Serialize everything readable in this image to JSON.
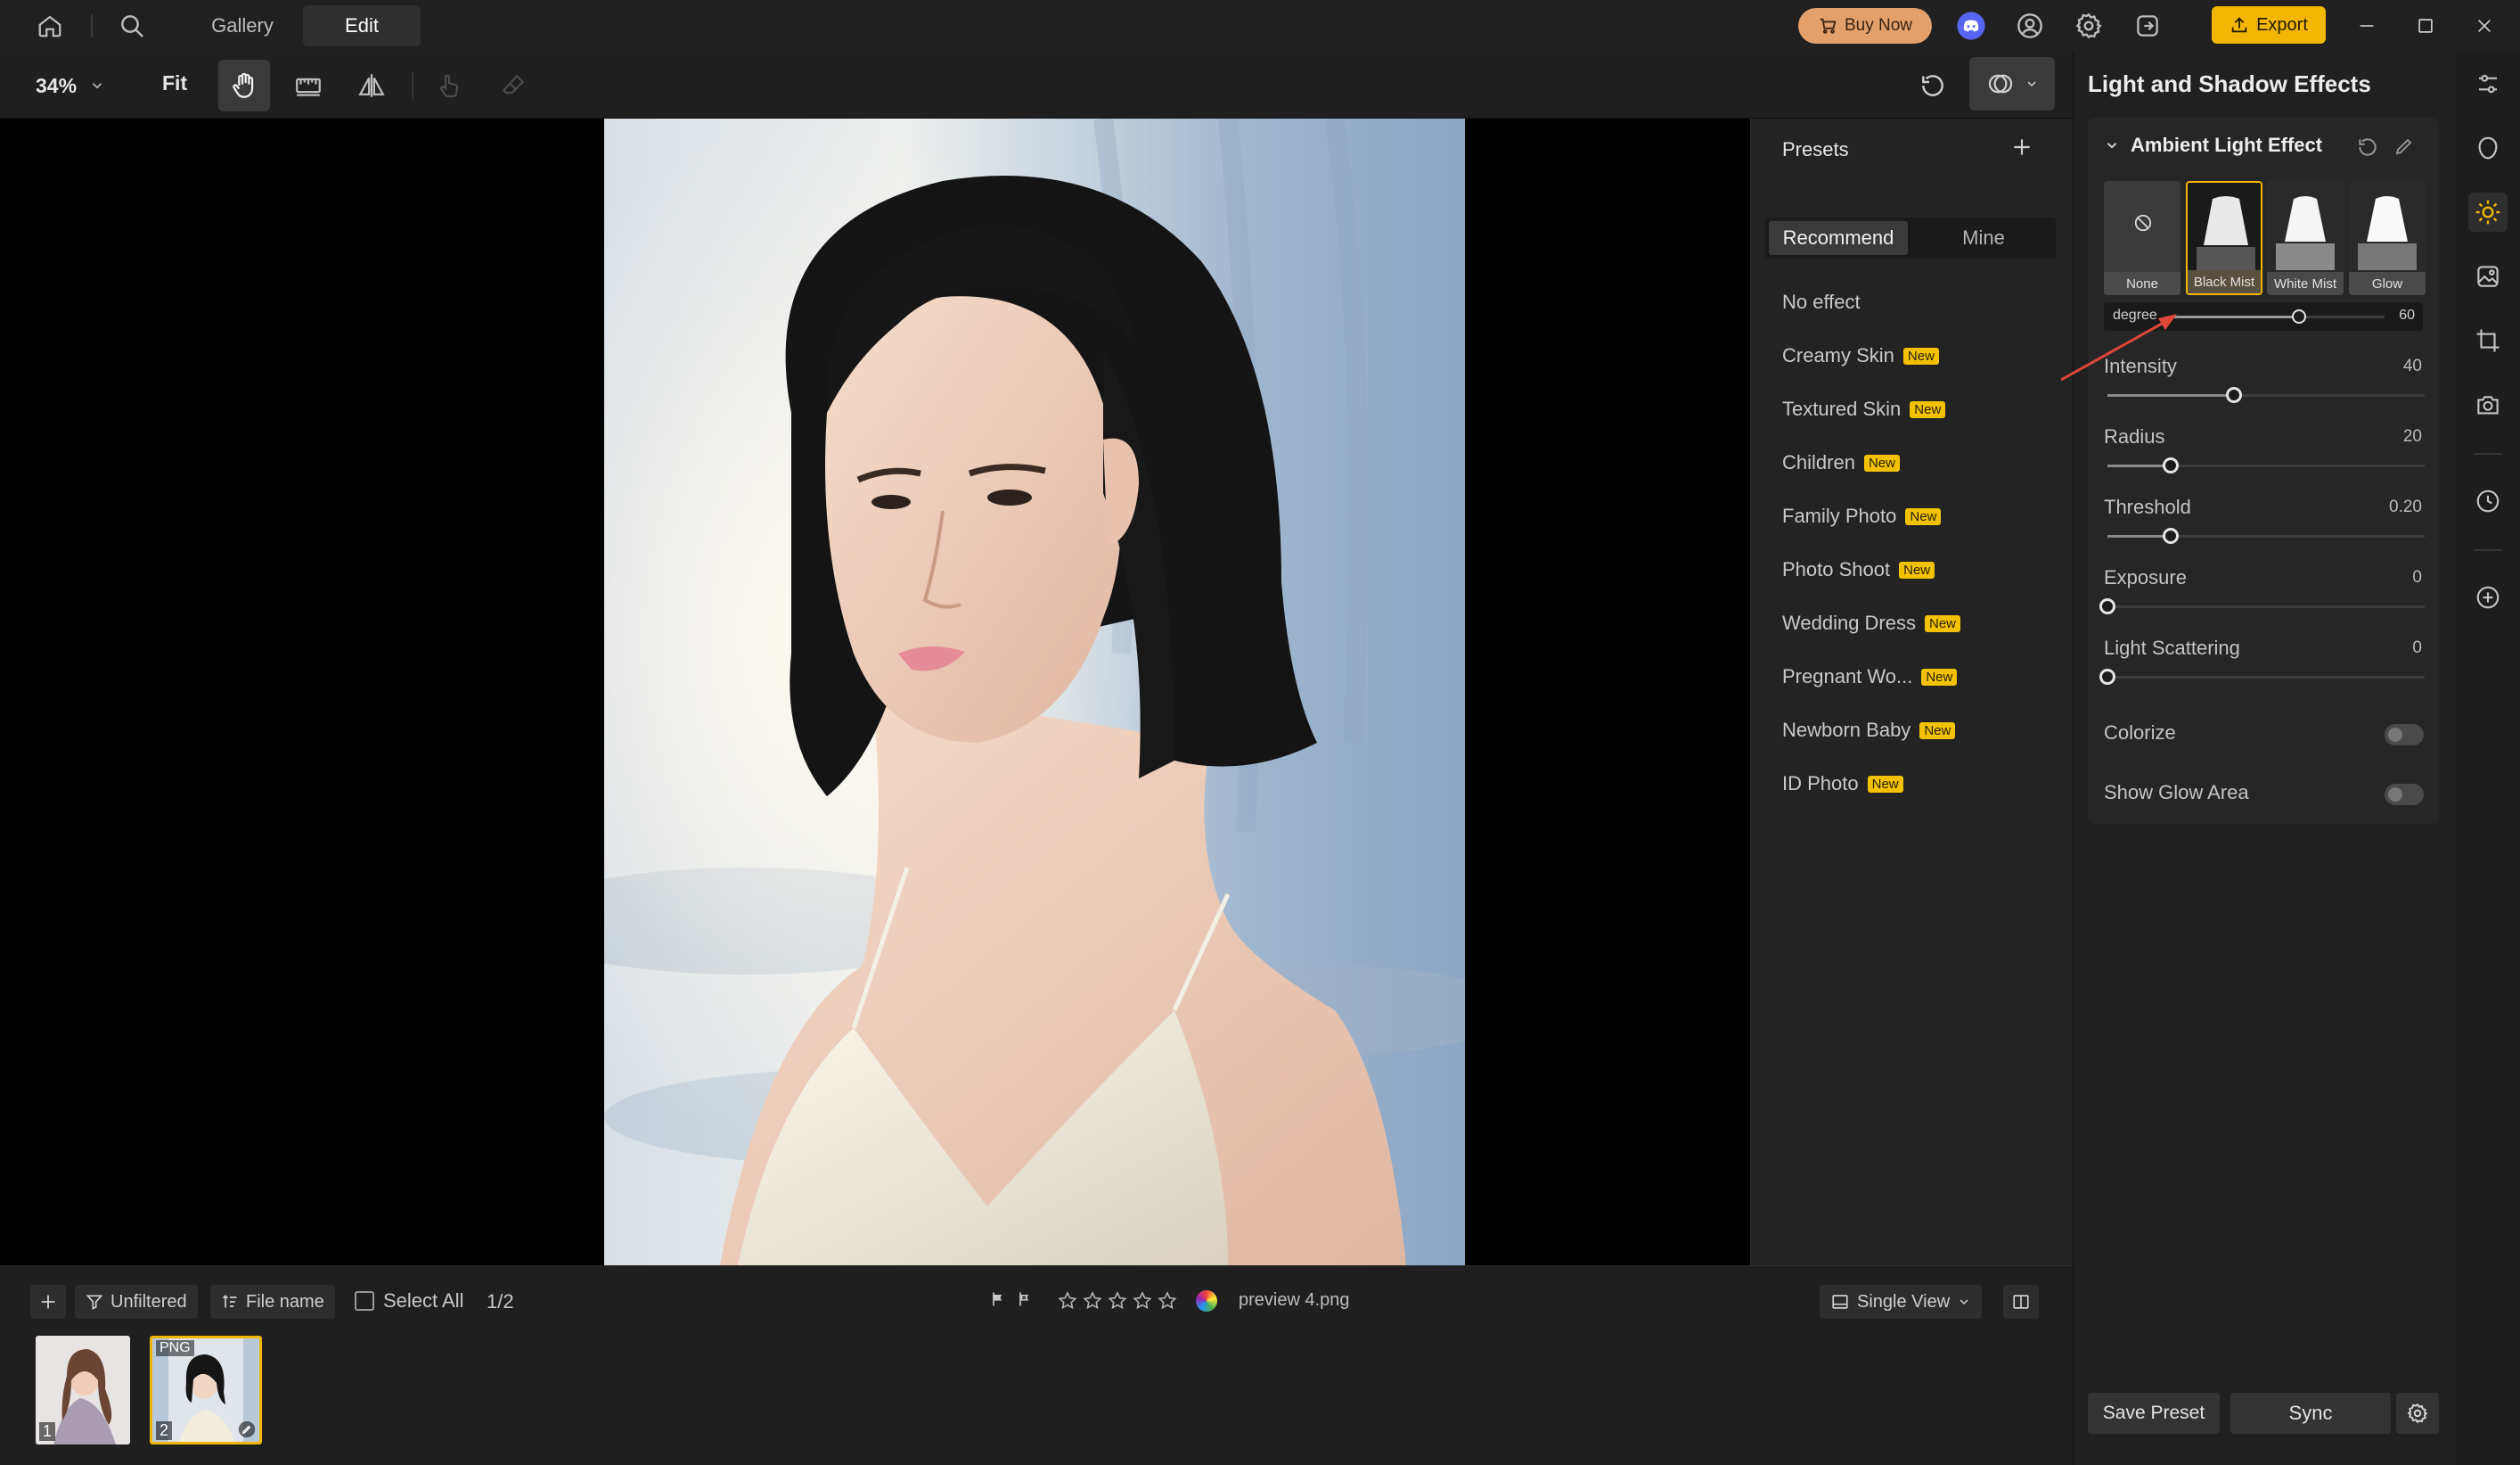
{
  "topbar": {
    "tabs": [
      {
        "label": "Gallery"
      },
      {
        "label": "Edit"
      }
    ],
    "buy_now": "Buy Now",
    "export": "Export"
  },
  "toolbar": {
    "zoom": "34%",
    "fit": "Fit"
  },
  "presets": {
    "title": "Presets",
    "tabs": [
      {
        "label": "Recommend"
      },
      {
        "label": "Mine"
      }
    ],
    "items": [
      {
        "label": "No effect",
        "badge": ""
      },
      {
        "label": "Creamy Skin",
        "badge": "New"
      },
      {
        "label": "Textured Skin",
        "badge": "New"
      },
      {
        "label": "Children",
        "badge": "New"
      },
      {
        "label": "Family Photo",
        "badge": "New"
      },
      {
        "label": "Photo Shoot",
        "badge": "New"
      },
      {
        "label": "Wedding Dress",
        "badge": "New"
      },
      {
        "label": "Pregnant Wo...",
        "badge": "New"
      },
      {
        "label": "Newborn Baby",
        "badge": "New"
      },
      {
        "label": "ID Photo",
        "badge": "New"
      }
    ]
  },
  "panel": {
    "title": "Light and Shadow Effects",
    "section": "Ambient Light Effect",
    "effects": [
      {
        "label": "None",
        "selected": false
      },
      {
        "label": "Black Mist",
        "selected": true
      },
      {
        "label": "White Mist",
        "selected": false
      },
      {
        "label": "Glow",
        "selected": false
      }
    ],
    "degree": {
      "label": "degree",
      "value": "60",
      "level": 0.6
    },
    "sliders": [
      {
        "label": "Intensity",
        "value": "40",
        "level": 0.4
      },
      {
        "label": "Radius",
        "value": "20",
        "level": 0.2
      },
      {
        "label": "Threshold",
        "value": "0.20",
        "level": 0.2
      },
      {
        "label": "Exposure",
        "value": "0",
        "level": 0.0
      },
      {
        "label": "Light Scattering",
        "value": "0",
        "level": 0.0
      }
    ],
    "colorize": "Colorize",
    "show_glow_area": "Show Glow Area",
    "save_preset": "Save Preset",
    "sync": "Sync"
  },
  "bottom": {
    "unfiltered": "Unfiltered",
    "file_name": "File name",
    "select_all": "Select All",
    "count": "1/2",
    "filename": "preview 4.png",
    "single_view": "Single View",
    "thumbs": [
      {
        "index": "1",
        "tag": ""
      },
      {
        "index": "2",
        "tag": "PNG"
      }
    ]
  },
  "colors": {
    "accent": "#f2b705",
    "buy_now": "#e3a06b",
    "annotation_arrow": "#e0463a"
  }
}
